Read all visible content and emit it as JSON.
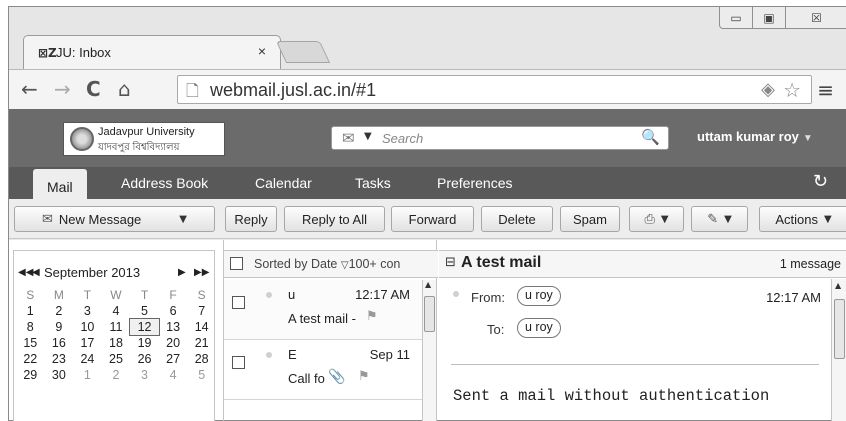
{
  "browser": {
    "tab_title": "JU: Inbox",
    "tab_icon_text": "⊠Z",
    "tab_close": "×",
    "url": "webmail.jusl.ac.in/#1",
    "window_controls": {
      "minimize": "▭",
      "maximize": "▣",
      "close": "☒"
    }
  },
  "header": {
    "logo_line1": "Jadavpur University",
    "logo_line2": "যাদবপুর বিশ্ববিদ্যালয়",
    "search_placeholder": "Search",
    "username": "uttam kumar roy"
  },
  "nav": {
    "tabs": [
      "Mail",
      "Address Book",
      "Calendar",
      "Tasks",
      "Preferences"
    ]
  },
  "toolbar": {
    "new_message": "New Message",
    "reply": "Reply",
    "reply_all": "Reply to All",
    "forward": "Forward",
    "delete": "Delete",
    "spam": "Spam",
    "actions": "Actions"
  },
  "calendar": {
    "month": "September 2013",
    "weekdays": [
      "S",
      "M",
      "T",
      "W",
      "T",
      "F",
      "S"
    ],
    "weeks": [
      [
        "1",
        "2",
        "3",
        "4",
        "5",
        "6",
        "7"
      ],
      [
        "8",
        "9",
        "10",
        "11",
        "12",
        "13",
        "14"
      ],
      [
        "15",
        "16",
        "17",
        "18",
        "19",
        "20",
        "21"
      ],
      [
        "22",
        "23",
        "24",
        "25",
        "26",
        "27",
        "28"
      ],
      [
        "29",
        "30",
        "1",
        "2",
        "3",
        "4",
        "5"
      ]
    ],
    "today": "12"
  },
  "message_list": {
    "sort_label": "Sorted by Date",
    "count_label": "100+ con",
    "items": [
      {
        "from": "u",
        "time": "12:17 AM",
        "subject": "A test mail -"
      },
      {
        "from": "E",
        "time": "Sep 11",
        "subject": "Call fo"
      }
    ]
  },
  "preview": {
    "subject": "A test mail",
    "message_count": "1 message",
    "from_label": "From:",
    "from_value": "u roy",
    "to_label": "To:",
    "to_value": "u roy",
    "time": "12:17 AM",
    "body": "Sent a mail without authentication"
  }
}
